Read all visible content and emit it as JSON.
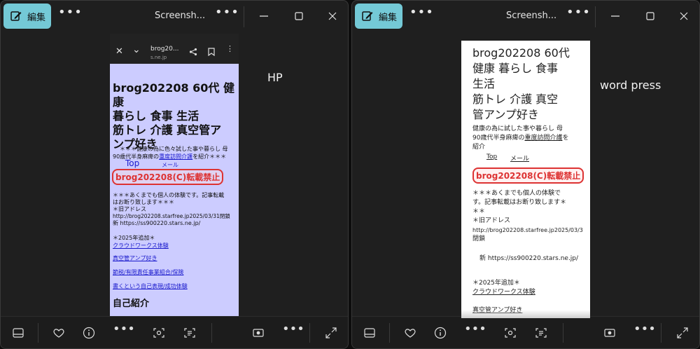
{
  "left_window": {
    "edit_label": "編集",
    "title": "Screensh...",
    "side_label": "HP",
    "phone": {
      "url": "brog20...",
      "url_sub": "s.ne.jp",
      "heading_lines": [
        "brog202208 60代 健康",
        "暮らし 食事 生活",
        "筋トレ 介護 真空管ア",
        "ンプ好き"
      ],
      "intro_line1": "＊＊＊健康の為に色々試した事や暮らし 母",
      "intro_line2_pre": "90歳代半身麻痺の",
      "intro_link": "重度訪問介護",
      "intro_line2_post": "を紹介＊＊＊",
      "nav_top": "Top",
      "nav_mail": "メール",
      "stamp": "brog202208(C)転載禁止",
      "notice_line1": "＊＊＊あくまでも個人の体験です。記事転載",
      "notice_line2": "はお断り致します＊＊＊",
      "old_address_label": "＊旧アドレス",
      "old_address": "http://brog202208.starfree.jp2025/03/31閉鎖",
      "new_address": "新 https://ss900220.stars.ne.jp/",
      "added_label": "＊2025年追加＊",
      "links": [
        "クラウドワークス体験",
        "真空管アンプ好き",
        "節税/有限責任事業組合/保険",
        "書くという自己表現/成功体験"
      ],
      "section_title": "自己紹介"
    }
  },
  "right_window": {
    "edit_label": "編集",
    "title": "Screensh...",
    "side_label": "word press",
    "wp": {
      "heading_lines": [
        "brog202208 60代",
        "健康 暮らし 食事",
        "生活",
        "筋トレ 介護 真空",
        "管アンプ好き"
      ],
      "intro_line1": "健康の為に試した事や暮らし 母",
      "intro_line2_pre": "90歳代半身麻痺の",
      "intro_link": "重度訪問介護",
      "intro_line2_post": "を",
      "intro_line3": "紹介",
      "nav_top": "Top",
      "nav_mail": "メール",
      "stamp": "brog202208(C)転載禁止",
      "notice_line1": "＊＊＊あくまでも個人の体験で",
      "notice_line2": "す。記事転載はお断り致します＊",
      "notice_line3": "＊＊",
      "old_address_label": "＊旧アドレス",
      "old_address": "http://brog202208.starfree.jp2025/03/3",
      "old_address_tail": "閉鎖",
      "new_address": "新 https://ss900220.stars.ne.jp/",
      "added_label": "＊2025年追加＊",
      "link1": "クラウドワークス体験",
      "link2": "真空管アンプ好き"
    }
  },
  "icons": {
    "edit": "edit-pencil-icon",
    "more": "more-dots-icon",
    "minimize": "minimize-icon",
    "maximize": "maximize-icon",
    "close": "close-icon",
    "filmstrip": "filmstrip-icon",
    "favorite": "heart-icon",
    "info": "info-icon",
    "visual_search": "visual-search-icon",
    "text_scan": "text-scan-icon",
    "slideshow": "slideshow-icon",
    "fullscreen": "fullscreen-icon"
  }
}
